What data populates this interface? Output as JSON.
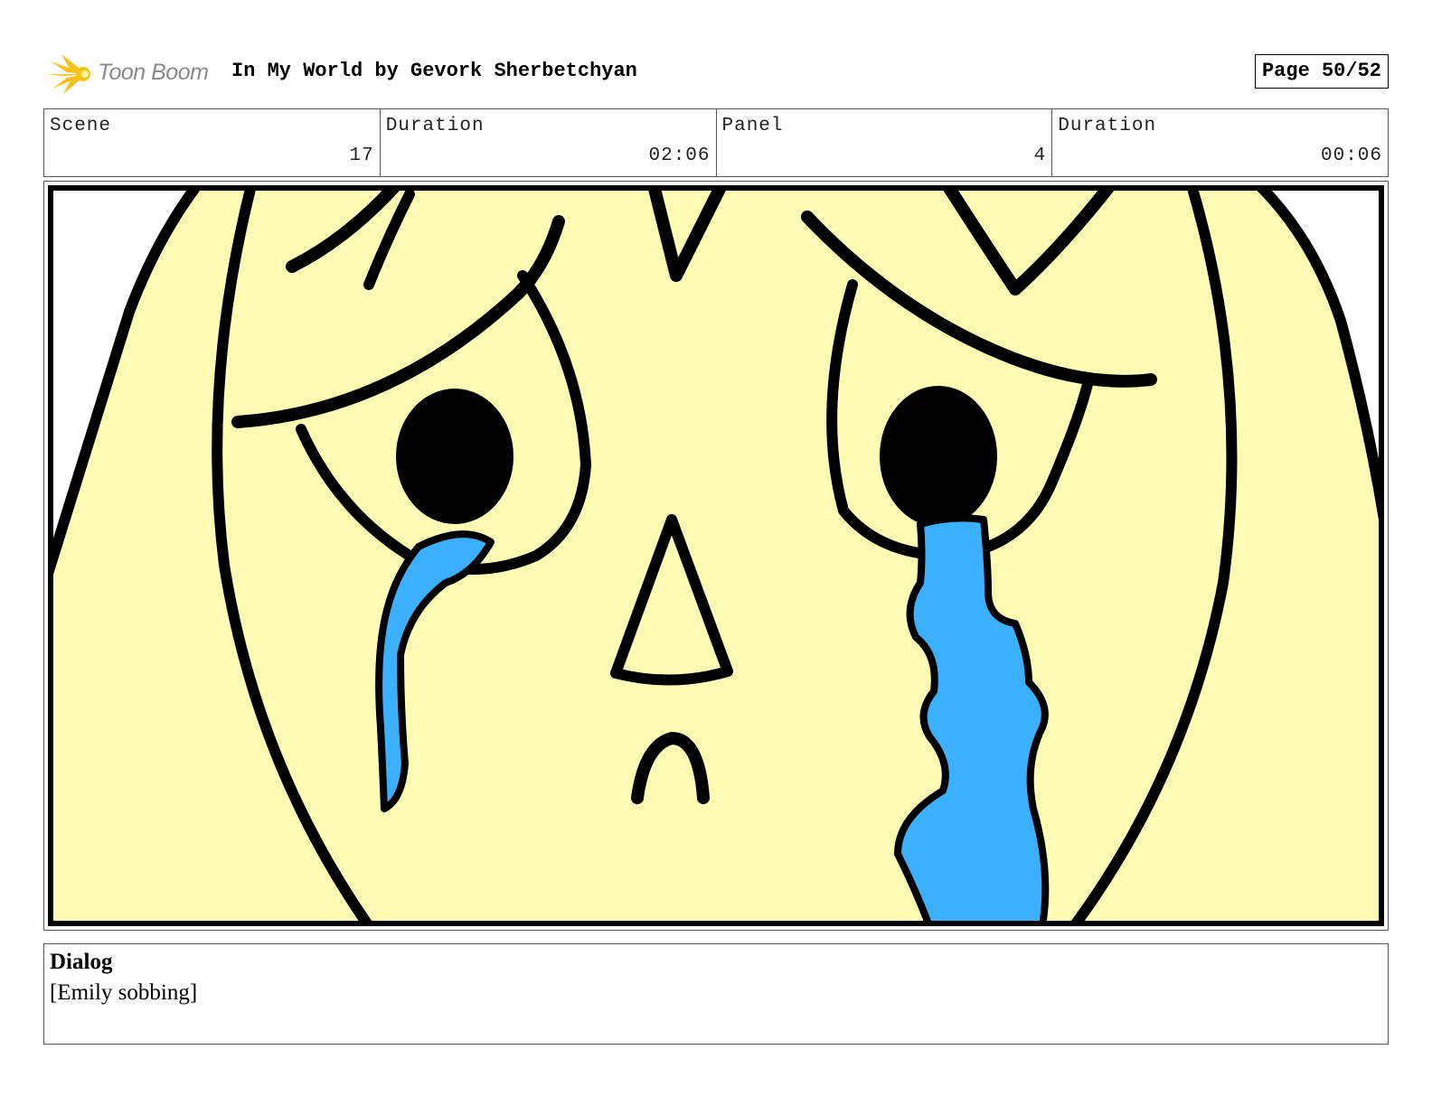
{
  "header": {
    "logo_text": "Toon Boom",
    "title": "In My World by Gevork Sherbetchyan",
    "page_indicator": "Page 50/52"
  },
  "info": {
    "scene_label": "Scene",
    "scene_value": "17",
    "scene_duration_label": "Duration",
    "scene_duration_value": "02:06",
    "panel_label": "Panel",
    "panel_value": "4",
    "panel_duration_label": "Duration",
    "panel_duration_value": "00:06"
  },
  "dialog": {
    "heading": "Dialog",
    "text": "[Emily sobbing]"
  },
  "colors": {
    "skin": "#fdfbb4",
    "tears": "#3ab0ff",
    "ink": "#000000",
    "logo_accent": "#f6c219"
  },
  "panel_art_icon": "crying-face-drawing"
}
